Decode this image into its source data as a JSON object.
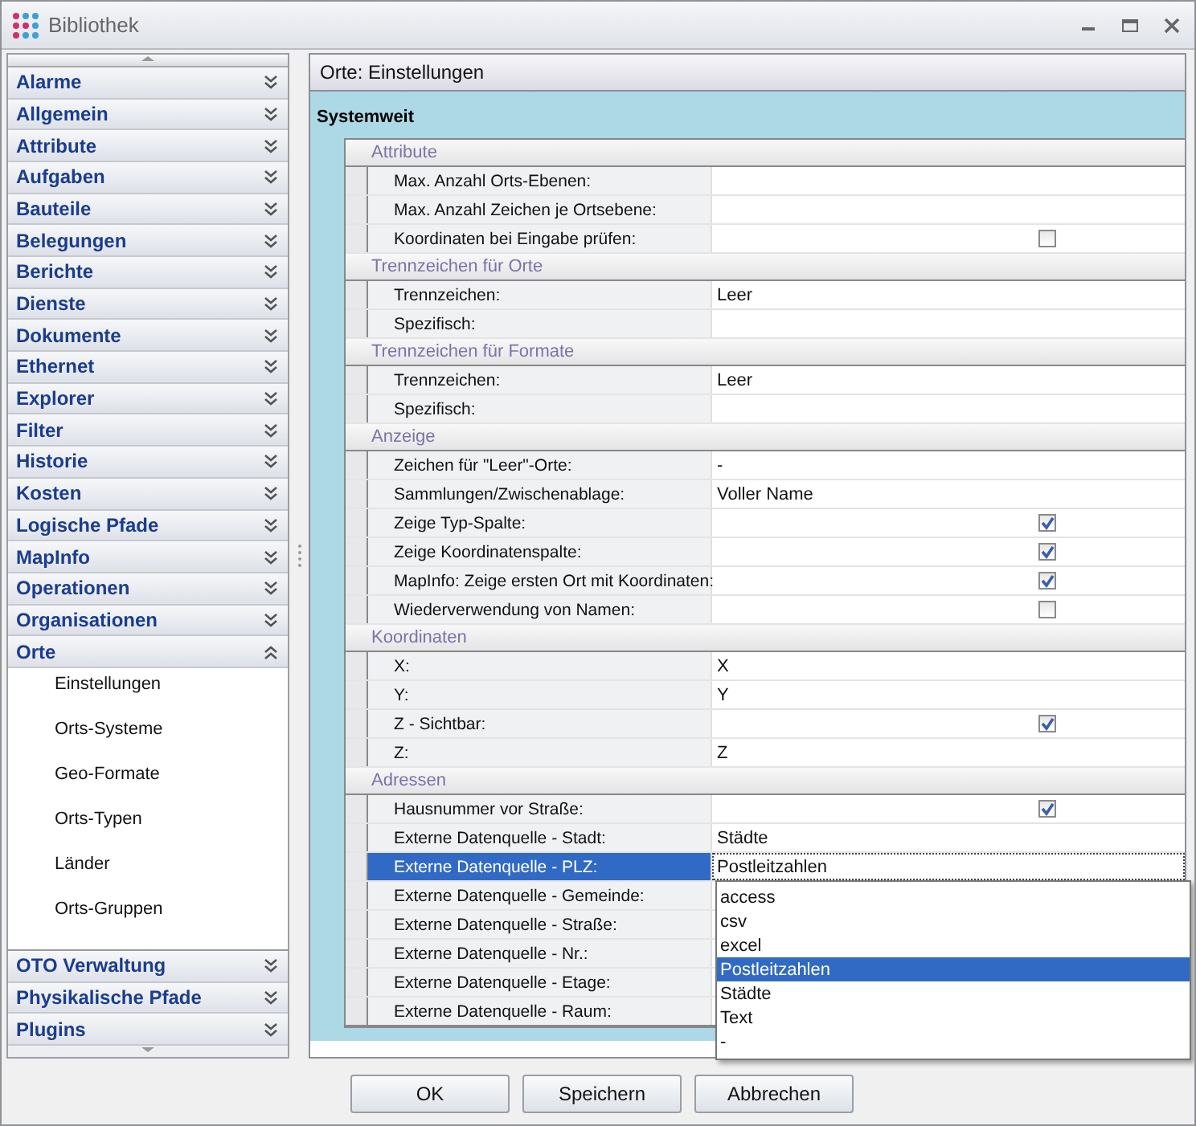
{
  "window": {
    "title": "Bibliothek"
  },
  "sidebar": {
    "items": [
      {
        "label": "Alarme",
        "expanded": false
      },
      {
        "label": "Allgemein",
        "expanded": false
      },
      {
        "label": "Attribute",
        "expanded": false
      },
      {
        "label": "Aufgaben",
        "expanded": false
      },
      {
        "label": "Bauteile",
        "expanded": false
      },
      {
        "label": "Belegungen",
        "expanded": false
      },
      {
        "label": "Berichte",
        "expanded": false
      },
      {
        "label": "Dienste",
        "expanded": false
      },
      {
        "label": "Dokumente",
        "expanded": false
      },
      {
        "label": "Ethernet",
        "expanded": false
      },
      {
        "label": "Explorer",
        "expanded": false
      },
      {
        "label": "Filter",
        "expanded": false
      },
      {
        "label": "Historie",
        "expanded": false
      },
      {
        "label": "Kosten",
        "expanded": false
      },
      {
        "label": "Logische Pfade",
        "expanded": false
      },
      {
        "label": "MapInfo",
        "expanded": false
      },
      {
        "label": "Operationen",
        "expanded": false
      },
      {
        "label": "Organisationen",
        "expanded": false
      },
      {
        "label": "Orte",
        "expanded": true,
        "children": [
          {
            "label": "Einstellungen"
          },
          {
            "label": "Orts-Systeme"
          },
          {
            "label": "Geo-Formate"
          },
          {
            "label": "Orts-Typen"
          },
          {
            "label": "Länder"
          },
          {
            "label": "Orts-Gruppen"
          }
        ]
      },
      {
        "label": "OTO Verwaltung",
        "expanded": false
      },
      {
        "label": "Physikalische Pfade",
        "expanded": false
      },
      {
        "label": "Plugins",
        "expanded": false
      }
    ]
  },
  "panel": {
    "title": "Orte: Einstellungen",
    "section": "Systemweit",
    "groups": [
      {
        "title": "Attribute",
        "rows": [
          {
            "kind": "text",
            "label": "Max. Anzahl Orts-Ebenen:",
            "selected": false
          },
          {
            "kind": "text",
            "label": "Max. Anzahl Zeichen je Ortsebene:",
            "selected": false
          },
          {
            "kind": "checkbox",
            "label": "Koordinaten bei Eingabe prüfen:",
            "checked": false,
            "selected": false
          }
        ]
      },
      {
        "title": "Trennzeichen für Orte",
        "rows": [
          {
            "kind": "text",
            "label": "Trennzeichen:",
            "value": "Leer",
            "selected": false
          },
          {
            "kind": "text",
            "label": "Spezifisch:",
            "selected": false
          }
        ]
      },
      {
        "title": "Trennzeichen für Formate",
        "rows": [
          {
            "kind": "text",
            "label": "Trennzeichen:",
            "value": "Leer",
            "selected": false
          },
          {
            "kind": "text",
            "label": "Spezifisch:",
            "selected": false
          }
        ]
      },
      {
        "title": "Anzeige",
        "rows": [
          {
            "kind": "text",
            "label": "Zeichen für \"Leer\"-Orte:",
            "value": "-",
            "selected": false
          },
          {
            "kind": "text",
            "label": "Sammlungen/Zwischenablage:",
            "value": "Voller Name",
            "selected": false
          },
          {
            "kind": "checkbox",
            "label": "Zeige Typ-Spalte:",
            "checked": true,
            "selected": false
          },
          {
            "kind": "checkbox",
            "label": "Zeige Koordinatenspalte:",
            "checked": true,
            "selected": false
          },
          {
            "kind": "checkbox",
            "label": "MapInfo: Zeige ersten Ort mit Koordinaten:",
            "checked": true,
            "selected": false
          },
          {
            "kind": "checkbox",
            "label": "Wiederverwendung von Namen:",
            "checked": false,
            "selected": false
          }
        ]
      },
      {
        "title": "Koordinaten",
        "rows": [
          {
            "kind": "text",
            "label": "X:",
            "value": "X",
            "selected": false
          },
          {
            "kind": "text",
            "label": "Y:",
            "value": "Y",
            "selected": false
          },
          {
            "kind": "checkbox",
            "label": "Z - Sichtbar:",
            "checked": true,
            "selected": false
          },
          {
            "kind": "text",
            "label": "Z:",
            "value": "Z",
            "selected": false
          }
        ]
      },
      {
        "title": "Adressen",
        "rows": [
          {
            "kind": "checkbox",
            "label": "Hausnummer vor Straße:",
            "checked": true,
            "selected": false
          },
          {
            "kind": "text",
            "label": "Externe Datenquelle - Stadt:",
            "value": "Städte",
            "selected": false
          },
          {
            "kind": "dropdown",
            "label": "Externe Datenquelle - PLZ:",
            "value": "Postleitzahlen",
            "selected": true,
            "options": [
              {
                "label": "access",
                "selected": false
              },
              {
                "label": "csv",
                "selected": false
              },
              {
                "label": "excel",
                "selected": false
              },
              {
                "label": "Postleitzahlen",
                "selected": true
              },
              {
                "label": "Städte",
                "selected": false
              },
              {
                "label": "Text",
                "selected": false
              },
              {
                "label": "-",
                "selected": false
              }
            ]
          },
          {
            "kind": "text",
            "label": "Externe Datenquelle - Gemeinde:",
            "selected": false
          },
          {
            "kind": "text",
            "label": "Externe Datenquelle - Straße:",
            "selected": false
          },
          {
            "kind": "text",
            "label": "Externe Datenquelle - Nr.:",
            "selected": false
          },
          {
            "kind": "text",
            "label": "Externe Datenquelle - Etage:",
            "selected": false
          },
          {
            "kind": "text",
            "label": "Externe Datenquelle - Raum:",
            "selected": false
          }
        ]
      }
    ]
  },
  "buttons": [
    "OK",
    "Speichern",
    "Abbrechen"
  ]
}
